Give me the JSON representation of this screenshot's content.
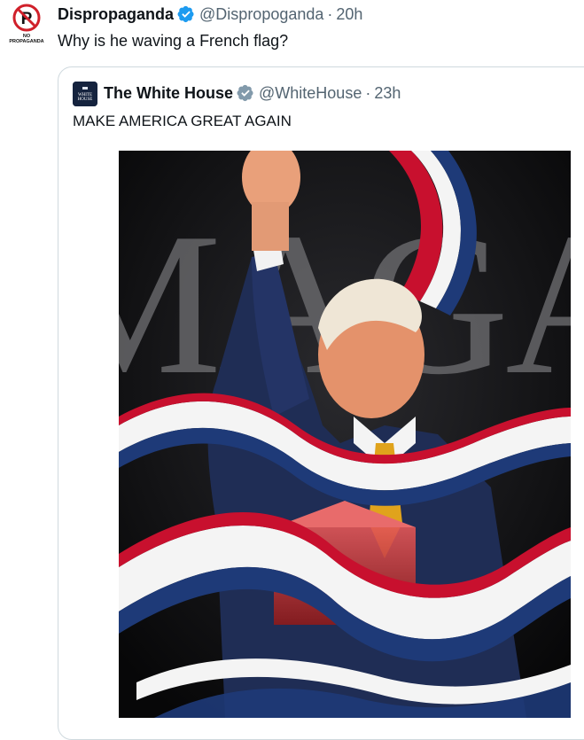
{
  "tweet": {
    "display_name": "Dispropaganda",
    "handle": "@Dispropoganda",
    "separator": "·",
    "time": "20h",
    "text": "Why is he waving a French flag?",
    "avatar_icon": "no-propaganda-logo-icon",
    "avatar_caption": "NO PROPAGANDA"
  },
  "quote": {
    "display_name": "The White House",
    "handle": "@WhiteHouse",
    "separator": "·",
    "time": "23h",
    "text": "MAKE AMERICA GREAT AGAIN",
    "avatar_icon": "white-house-logo-icon",
    "avatar_caption": "THE WHITE HOUSE",
    "media": {
      "poster_text": "MAGA",
      "description_icon": "maga-poster-image"
    }
  },
  "colors": {
    "verified_blue": "#1d9bf0",
    "verified_gray": "#829aab",
    "text_primary": "#0f1419",
    "text_secondary": "#536471",
    "border": "#cfd9de",
    "ribbon_red": "#c8102e",
    "ribbon_blue": "#1e3a78",
    "ribbon_white": "#f4f4f4"
  }
}
